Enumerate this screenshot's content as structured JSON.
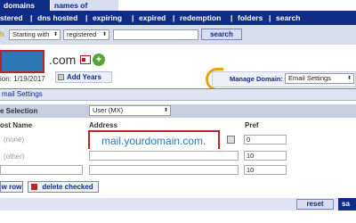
{
  "tabs": [
    {
      "label": "domains"
    },
    {
      "label": "names of interest"
    }
  ],
  "nav": [
    "stered",
    "dns hosted",
    "expiring",
    "expired",
    "redemption",
    "folders",
    "search"
  ],
  "search": {
    "label": "h",
    "match_type": "Starting with",
    "status": "registered",
    "query": "",
    "button": "search"
  },
  "domain": {
    "tld_text": ".com",
    "expiry_text": "ion: 1/19/2017",
    "add_years": "Add Years"
  },
  "manage": {
    "label": "Manage Domain:",
    "selected": "Email Settings"
  },
  "section": {
    "title": "mail Settings"
  },
  "type_selection": {
    "label": "e Selection",
    "selected": "User (MX)"
  },
  "columns": {
    "host": "ost Name",
    "address": "Address",
    "pref": "Pref"
  },
  "rows": [
    {
      "host_hint": "(none)",
      "address": "mail.yourdomain.com.",
      "pref": "0"
    },
    {
      "host_hint": "(other)",
      "address": "",
      "pref": "10"
    },
    {
      "host_hint": "",
      "address": "",
      "pref": "10"
    }
  ],
  "buttons": {
    "new_row": "w row",
    "delete_checked": "delete checked",
    "reset": "reset",
    "save": "sa"
  },
  "colors": {
    "brand_blue": "#0f2d86",
    "accent_orange": "#e8a20c",
    "highlight_red": "#c0222b"
  }
}
